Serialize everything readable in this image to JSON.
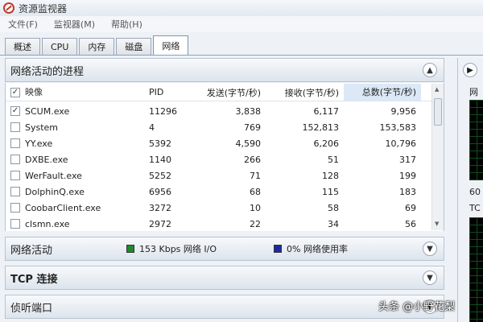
{
  "window": {
    "title": "资源监视器"
  },
  "menu": [
    "文件(F)",
    "监视器(M)",
    "帮助(H)"
  ],
  "tabs": [
    "概述",
    "CPU",
    "内存",
    "磁盘",
    "网络"
  ],
  "active_tab": "网络",
  "process_section": {
    "title": "网络活动的进程",
    "columns": [
      "映像",
      "PID",
      "发送(字节/秒)",
      "接收(字节/秒)",
      "总数(字节/秒)"
    ],
    "rows": [
      {
        "image": "SCUM.exe",
        "pid": "11296",
        "send": "3,838",
        "recv": "6,117",
        "total": "9,956",
        "checked": true
      },
      {
        "image": "System",
        "pid": "4",
        "send": "769",
        "recv": "152,813",
        "total": "153,583",
        "checked": false
      },
      {
        "image": "YY.exe",
        "pid": "5392",
        "send": "4,590",
        "recv": "6,206",
        "total": "10,796",
        "checked": false
      },
      {
        "image": "DXBE.exe",
        "pid": "1140",
        "send": "266",
        "recv": "51",
        "total": "317",
        "checked": false
      },
      {
        "image": "WerFault.exe",
        "pid": "5252",
        "send": "71",
        "recv": "128",
        "total": "199",
        "checked": false
      },
      {
        "image": "DolphinQ.exe",
        "pid": "6956",
        "send": "68",
        "recv": "115",
        "total": "183",
        "checked": false
      },
      {
        "image": "CoobarClient.exe",
        "pid": "3272",
        "send": "10",
        "recv": "58",
        "total": "69",
        "checked": false
      },
      {
        "image": "clsmn.exe",
        "pid": "2972",
        "send": "22",
        "recv": "34",
        "total": "56",
        "checked": false
      }
    ]
  },
  "network_activity": {
    "title": "网络活动",
    "io_text": "153 Kbps 网络 I/O",
    "usage_text": "0% 网络使用率",
    "io_color": "#1f8a2e",
    "usage_color": "#1c2aa0"
  },
  "tcp": {
    "title": "TCP 连接"
  },
  "listen": {
    "title": "侦听端口"
  },
  "right_pane": {
    "label_top": "网",
    "label_mid": "60",
    "label_tcp": "TC"
  },
  "watermark": "头条 @小野花梨"
}
